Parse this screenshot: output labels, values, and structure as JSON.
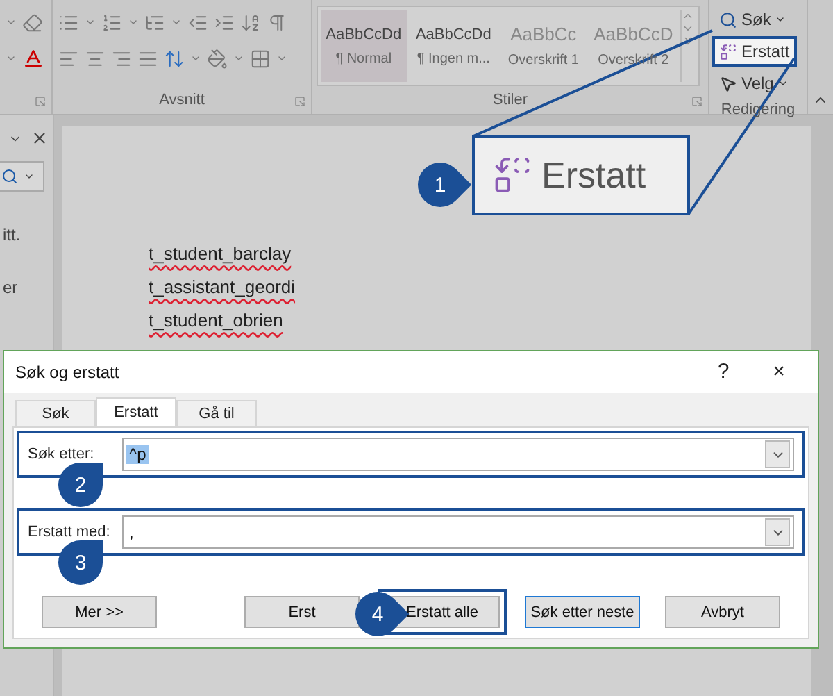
{
  "ribbon": {
    "groups": [
      {
        "label": "Avsnitt"
      },
      {
        "label": "Stiler"
      },
      {
        "label": "Redigering"
      }
    ],
    "styles": [
      {
        "preview": "AaBbCcDd",
        "name": "¶ Normal",
        "selected": true
      },
      {
        "preview": "AaBbCcDd",
        "name": "¶ Ingen m...",
        "selected": false
      },
      {
        "preview": "AaBbCc",
        "name": "Overskrift 1",
        "selected": false,
        "kind": "heading"
      },
      {
        "preview": "AaBbCcD",
        "name": "Overskrift 2",
        "selected": false,
        "kind": "heading"
      }
    ],
    "editing": [
      {
        "label": "Søk",
        "kind": "search",
        "highlighted": false
      },
      {
        "label": "Erstatt",
        "kind": "replace",
        "highlighted": true
      },
      {
        "label": "Velg",
        "kind": "select",
        "highlighted": false
      }
    ]
  },
  "magnified": {
    "label": "Erstatt"
  },
  "nav_pane": {
    "texts": [
      "itt.",
      "er"
    ]
  },
  "document": {
    "lines": [
      "t_student_barclay",
      "t_assistant_geordi",
      "t_student_obrien"
    ]
  },
  "dialog": {
    "title": "Søk og erstatt",
    "help": "?",
    "close": "×",
    "tabs": [
      {
        "label": "Søk",
        "selected": false
      },
      {
        "label": "Erstatt",
        "selected": true
      },
      {
        "label": "Gå til",
        "selected": false
      }
    ],
    "find": {
      "label": "Søk etter:",
      "value": "^p",
      "value_selected": true
    },
    "replace": {
      "label": "Erstatt med:",
      "value": ","
    },
    "buttons": [
      {
        "label": "Mer >>",
        "highlighted": false,
        "default": false
      },
      {
        "label": "Erst",
        "highlighted": false,
        "default": false
      },
      {
        "label": "Erstatt alle",
        "highlighted": true,
        "default": false
      },
      {
        "label": "Søk etter neste",
        "highlighted": false,
        "default": true
      },
      {
        "label": "Avbryt",
        "highlighted": false,
        "default": false
      }
    ]
  },
  "callouts": [
    "1",
    "2",
    "3",
    "4"
  ]
}
